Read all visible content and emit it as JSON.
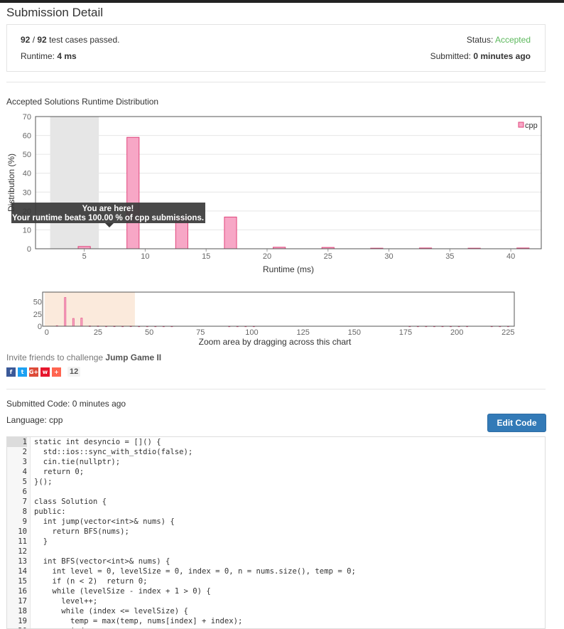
{
  "page": {
    "title": "Submission Detail"
  },
  "summary": {
    "passed": "92",
    "total": "92",
    "passed_suffix": " test cases passed.",
    "runtime_label": "Runtime: ",
    "runtime_value": "4 ms",
    "status_label": "Status: ",
    "status_value": "Accepted",
    "submitted_label": "Submitted: ",
    "submitted_value": "0 minutes ago"
  },
  "colors": {
    "accepted": "#5cb85c",
    "bar_fill": "#f7a7c6",
    "bar_stroke": "#e0457b",
    "button": "#337ab7"
  },
  "chart_data": [
    {
      "type": "bar",
      "title": "Accepted Solutions Runtime Distribution",
      "xlabel": "Runtime (ms)",
      "ylabel": "Distribution (%)",
      "legend": "cpp",
      "legend_position": "top-right",
      "xlim": [
        1,
        42.5
      ],
      "ylim": [
        0,
        70
      ],
      "x_ticks": [
        5,
        10,
        15,
        20,
        25,
        30,
        35,
        40
      ],
      "y_ticks": [
        0,
        10,
        20,
        30,
        40,
        50,
        60,
        70
      ],
      "grid": true,
      "series": [
        {
          "name": "cpp",
          "x": [
            5,
            9,
            13,
            17,
            21,
            25,
            29,
            33,
            37,
            41
          ],
          "values": [
            1.2,
            59,
            16,
            16.8,
            0.8,
            0.7,
            0.3,
            0.4,
            0.3,
            0.4
          ]
        }
      ],
      "highlight_range": [
        2.2,
        6.2
      ],
      "tooltip": {
        "line1": "You are here!",
        "line2_prefix": "Your runtime beats ",
        "line2_value": "100.00",
        "line2_suffix": " % of cpp submissions."
      }
    },
    {
      "type": "bar",
      "role": "navigator",
      "caption": "Zoom area by dragging across this chart",
      "xlim": [
        -2,
        228
      ],
      "ylim": [
        0,
        70
      ],
      "x_ticks": [
        0,
        25,
        50,
        75,
        100,
        125,
        150,
        175,
        200,
        225
      ],
      "y_ticks": [
        0,
        25,
        50
      ],
      "selection_range": [
        -1,
        43
      ],
      "values_x": [
        5,
        9,
        13,
        17,
        21,
        25,
        29,
        33,
        37,
        41,
        45,
        49,
        53,
        57,
        61,
        89,
        93,
        97,
        101,
        177,
        181,
        185,
        189,
        193,
        197,
        201,
        205,
        217,
        221,
        225
      ],
      "values_y": [
        1.2,
        59,
        16,
        16.8,
        0.8,
        0.7,
        0.3,
        0.4,
        0.3,
        0.4,
        0.3,
        0.3,
        0.3,
        0.3,
        0.3,
        0.3,
        0.3,
        0.3,
        0.3,
        0.3,
        0.3,
        0.3,
        0.3,
        0.3,
        0.3,
        0.3,
        0.3,
        0.3,
        0.3,
        0.3
      ]
    }
  ],
  "invite": {
    "text": "Invite friends to challenge ",
    "problem": "Jump Game II",
    "share_count": "12",
    "share_buttons": [
      {
        "icon": "facebook-icon",
        "glyph": "f",
        "color": "#3b5998"
      },
      {
        "icon": "twitter-icon",
        "glyph": "t",
        "color": "#1da1f2"
      },
      {
        "icon": "google-plus-icon",
        "glyph": "G+",
        "color": "#dd4b39"
      },
      {
        "icon": "weibo-icon",
        "glyph": "w",
        "color": "#e6162d"
      },
      {
        "icon": "more-share-icon",
        "glyph": "+",
        "color": "#ff6550"
      }
    ]
  },
  "submission": {
    "submitted_code": "Submitted Code: 0 minutes ago",
    "language": "Language: cpp",
    "edit_button": "Edit Code"
  },
  "code": {
    "lines": [
      "static int desyncio = []() {",
      "  std::ios::sync_with_stdio(false);",
      "  cin.tie(nullptr);",
      "  return 0;",
      "}();",
      "",
      "class Solution {",
      "public:",
      "  int jump(vector<int>& nums) {",
      "    return BFS(nums);",
      "  }",
      "",
      "  int BFS(vector<int>& nums) {",
      "    int level = 0, levelSize = 0, index = 0, n = nums.size(), temp = 0;",
      "    if (n < 2)  return 0;",
      "    while (levelSize - index + 1 > 0) {",
      "      level++;",
      "      while (index <= levelSize) {",
      "        temp = max(temp, nums[index] + index);",
      "        index++;"
    ]
  }
}
